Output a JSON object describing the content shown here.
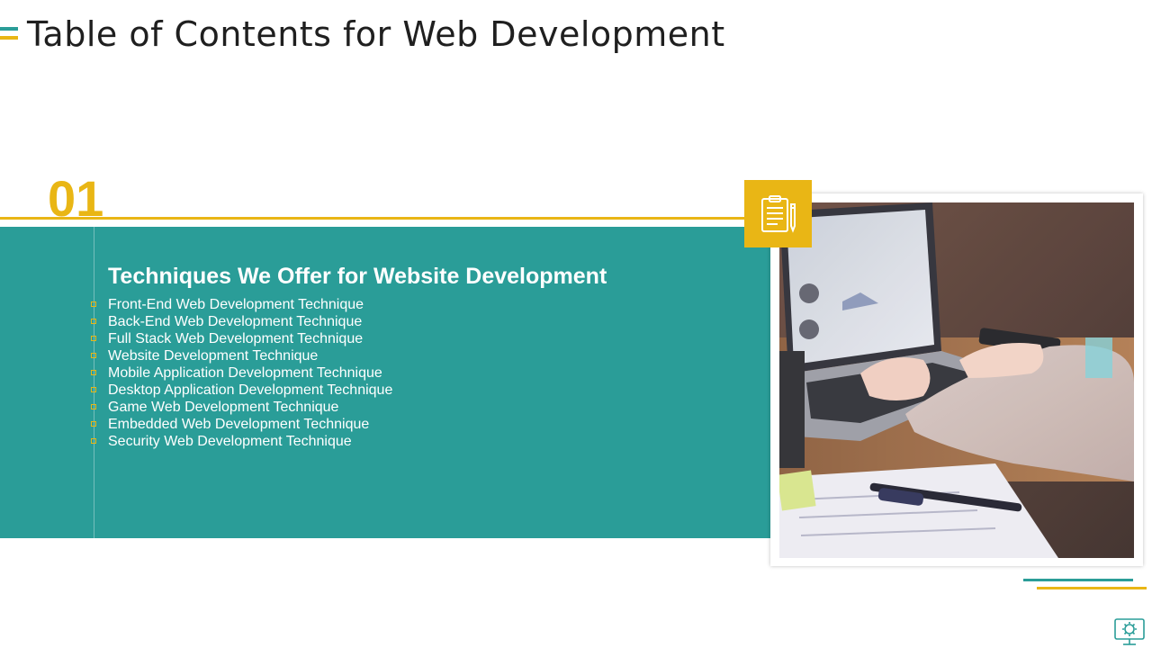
{
  "page": {
    "title": "Table of Contents for Web Development"
  },
  "section": {
    "number": "01",
    "heading": "Techniques We Offer  for Website Development",
    "items": [
      {
        "label": "Front-End Web Development Technique"
      },
      {
        "label": "Back-End Web Development Technique"
      },
      {
        "label": "Full Stack Web Development Technique"
      },
      {
        "label": "Website Development Technique"
      },
      {
        "label": "Mobile Application Development Technique"
      },
      {
        "label": "Desktop Application Development Technique"
      },
      {
        "label": "Game Web Development Technique"
      },
      {
        "label": "Embedded Web Development Technique"
      },
      {
        "label": "Security Web Development Technique"
      }
    ]
  },
  "icons": {
    "section_icon": "clipboard-pen-icon",
    "corner_icon": "gear-monitor-icon"
  },
  "colors": {
    "teal": "#2a9d98",
    "gold": "#e9b615",
    "title_text": "#1f1f1f",
    "panel_text": "#ffffff"
  }
}
